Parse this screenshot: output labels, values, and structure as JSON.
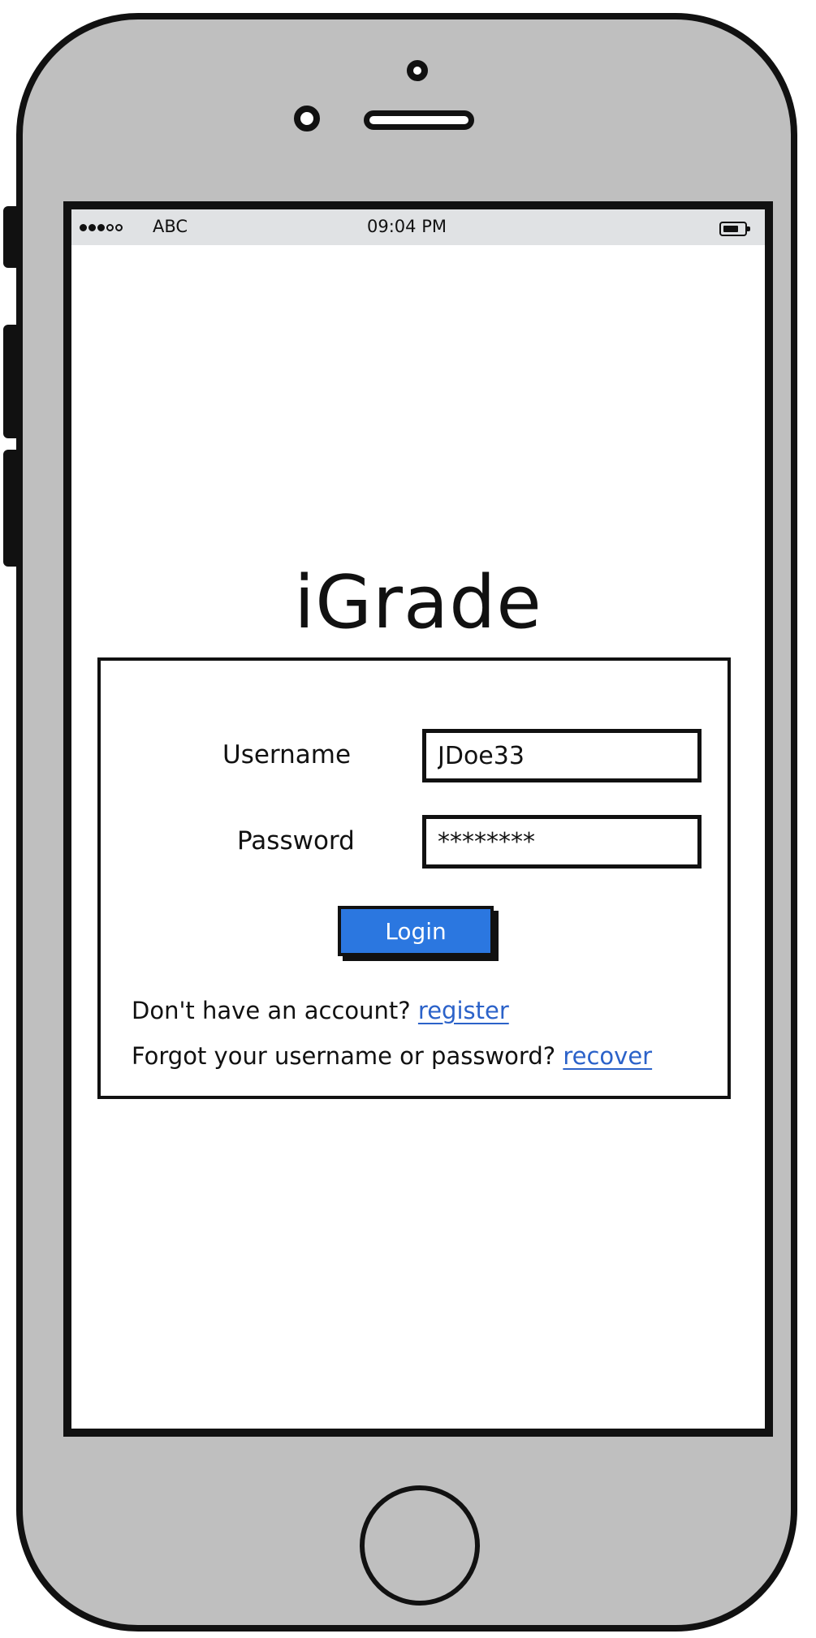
{
  "status_bar": {
    "signal_dots": {
      "filled": 3,
      "empty": 2
    },
    "carrier": "ABC",
    "time": "09:04 PM",
    "battery_icon": "battery-icon"
  },
  "app": {
    "title": "iGrade"
  },
  "login_form": {
    "username_label": "Username",
    "username_value": "JDoe33",
    "password_label": "Password",
    "password_value": "********",
    "login_button": "Login",
    "register_prompt": "Don't have an account?",
    "register_link": "register",
    "recover_prompt": "Forgot your username or password?",
    "recover_link": "recover"
  },
  "colors": {
    "phone_body": "#bfbfbf",
    "status_bar": "#e0e2e4",
    "button_primary": "#2b77e0",
    "link": "#2b62c9"
  }
}
